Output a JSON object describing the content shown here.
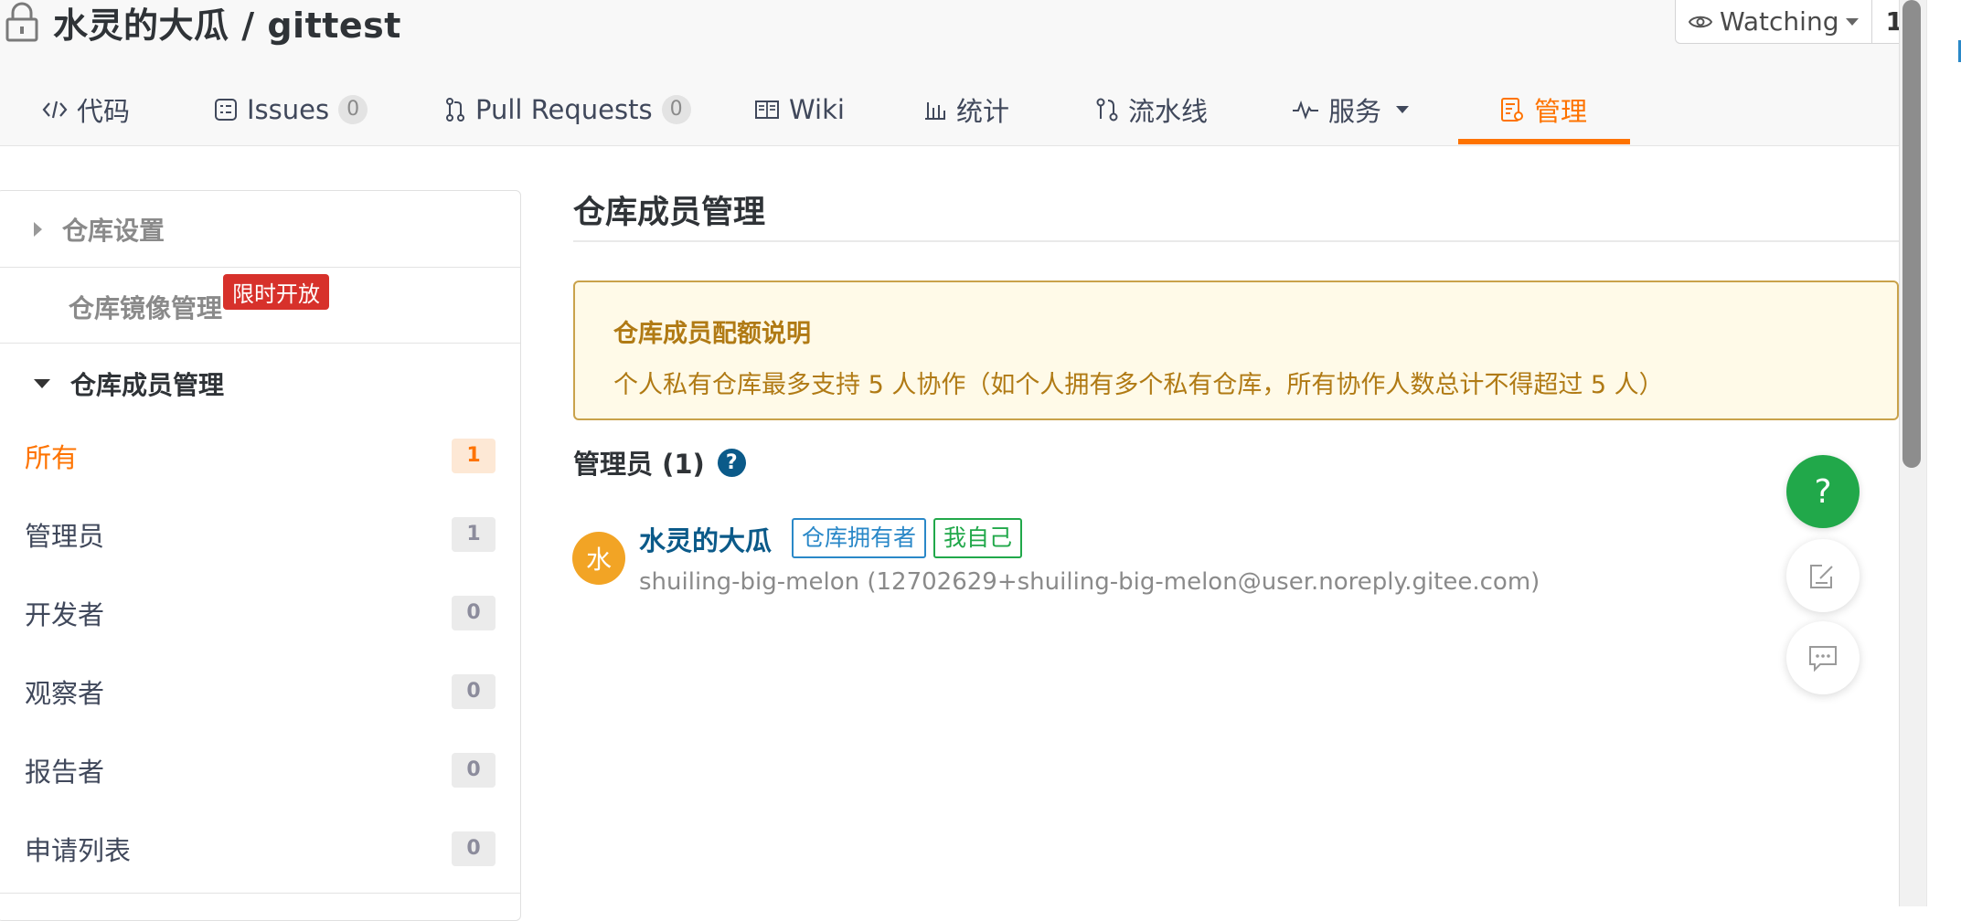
{
  "repo": {
    "title": "水灵的大瓜 / gittest"
  },
  "watch": {
    "label": "Watching",
    "count": "1"
  },
  "tabs": [
    {
      "label": "代码",
      "icon": "code-icon"
    },
    {
      "label": "Issues",
      "count": "0",
      "icon": "issues-icon"
    },
    {
      "label": "Pull Requests",
      "count": "0",
      "icon": "pull-request-icon"
    },
    {
      "label": "Wiki",
      "icon": "wiki-book-icon"
    },
    {
      "label": "统计",
      "icon": "bar-chart-icon"
    },
    {
      "label": "流水线",
      "icon": "pipeline-icon"
    },
    {
      "label": "服务",
      "icon": "activity-icon"
    },
    {
      "label": "管理",
      "icon": "manage-doc-icon",
      "active": true
    }
  ],
  "sidebar": {
    "repo_settings": "仓库设置",
    "mirror_management": "仓库镜像管理",
    "mirror_badge": "限时开放",
    "member_management": "仓库成员管理",
    "items": [
      {
        "label": "所有",
        "count": "1"
      },
      {
        "label": "管理员",
        "count": "1"
      },
      {
        "label": "开发者",
        "count": "0"
      },
      {
        "label": "观察者",
        "count": "0"
      },
      {
        "label": "报告者",
        "count": "0"
      },
      {
        "label": "申请列表",
        "count": "0"
      }
    ]
  },
  "main": {
    "title": "仓库成员管理",
    "notice_title": "仓库成员配额说明",
    "notice_text": "个人私有仓库最多支持 5 人协作（如个人拥有多个私有仓库，所有协作人数总计不得超过 5 人）",
    "admins_heading": "管理员 (1)",
    "member": {
      "avatar_char": "水",
      "name": "水灵的大瓜",
      "tag_owner": "仓库拥有者",
      "tag_self": "我自己",
      "detail": "shuiling-big-melon (12702629+shuiling-big-melon@user.noreply.gitee.com)"
    }
  },
  "floating": {
    "help_label": "?"
  },
  "colors": {
    "accent": "#fe7300",
    "link": "#0b5a89",
    "help_green": "#21a84a",
    "badge_red": "#d7312b"
  }
}
